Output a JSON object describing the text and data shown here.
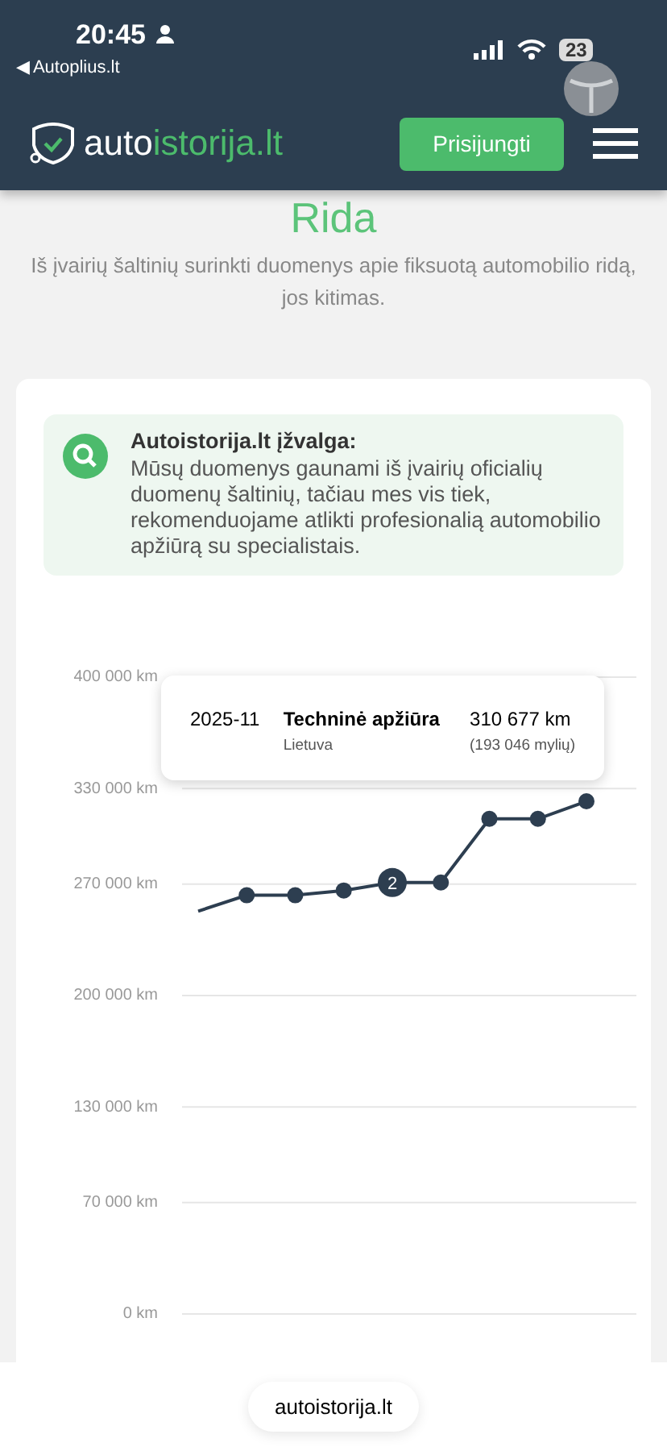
{
  "status_bar": {
    "time": "20:45",
    "back_link": "◀ Autoplius.lt",
    "battery": "23"
  },
  "header": {
    "logo_dark": "auto",
    "logo_green": "istorija.lt",
    "login_button": "Prisijungti"
  },
  "section": {
    "title": "Rida",
    "subtitle": "Iš įvairių šaltinių surinkti duomenys apie fiksuotą automobilio ridą, jos kitimas."
  },
  "insight": {
    "title": "Autoistorija.lt įžvalga:",
    "text": "Mūsų duomenys gaunami iš įvairių oficialių duomenų šaltinių, tačiau mes vis tiek, rekomenduojame atlikti profesionalią automobilio apžiūrą su specialistais."
  },
  "chart_data": {
    "type": "line",
    "ylim": [
      0,
      400000
    ],
    "yticks": [
      {
        "value": 0,
        "label": "0 km"
      },
      {
        "value": 70000,
        "label": "70 000 km"
      },
      {
        "value": 130000,
        "label": "130 000 km"
      },
      {
        "value": 200000,
        "label": "200 000 km"
      },
      {
        "value": 270000,
        "label": "270 000 km"
      },
      {
        "value": 330000,
        "label": "330 000 km"
      },
      {
        "value": 400000,
        "label": "400 000 km"
      }
    ],
    "grid": true,
    "series": [
      {
        "color": "#2d3e50",
        "marker": "circle",
        "values": [
          253000,
          263000,
          263000,
          266000,
          271000,
          271000,
          311000,
          311000,
          322000
        ]
      }
    ],
    "annotations": [
      {
        "y": 271000,
        "text": "2"
      }
    ]
  },
  "tooltip": {
    "date": "2025-11",
    "event": "Techninė apžiūra",
    "country": "Lietuva",
    "mileage": "310 677 km",
    "miles": "(193 046 mylių)"
  },
  "browser_bar": {
    "url": "autoistorija.lt"
  }
}
